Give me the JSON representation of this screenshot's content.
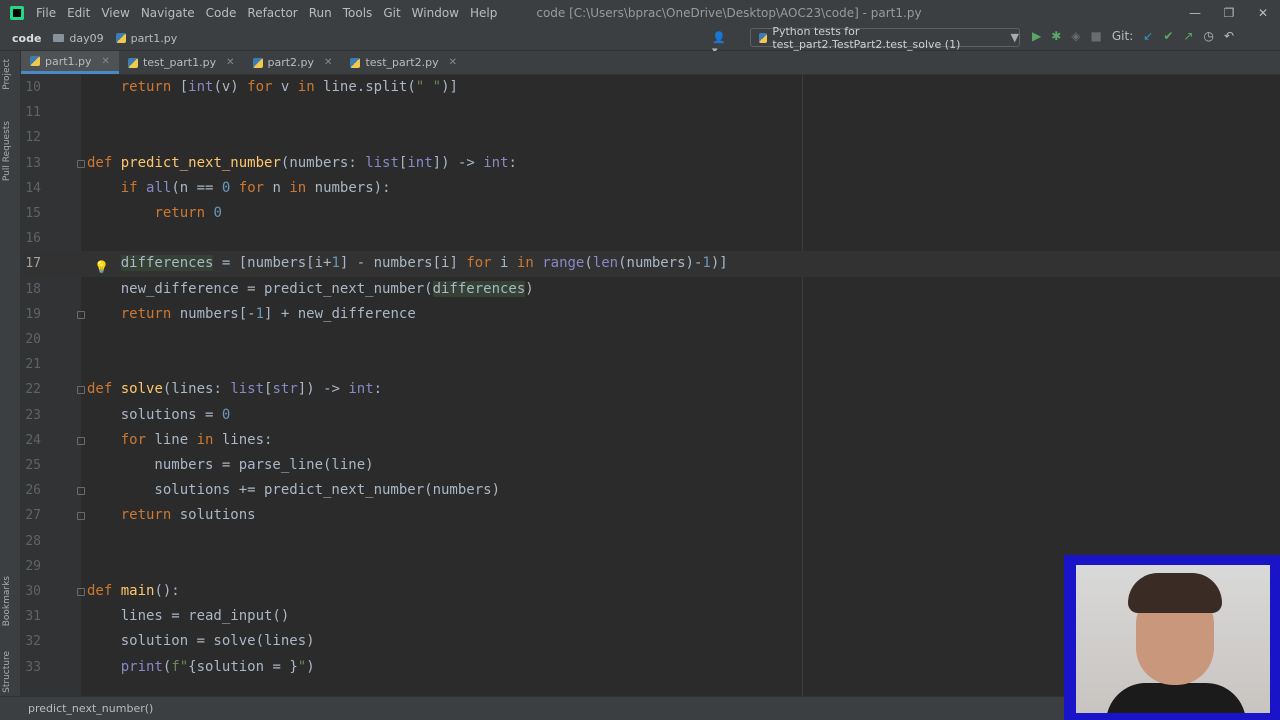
{
  "menubar": {
    "items": [
      "File",
      "Edit",
      "View",
      "Navigate",
      "Code",
      "Refactor",
      "Run",
      "Tools",
      "Git",
      "Window",
      "Help"
    ],
    "title": "code [C:\\Users\\bprac\\OneDrive\\Desktop\\AOC23\\code] - part1.py"
  },
  "navbar": {
    "crumbs": [
      "code",
      "day09",
      "part1.py"
    ],
    "run_config": "Python tests for test_part2.TestPart2.test_solve (1)",
    "git_label": "Git:"
  },
  "side_tabs": [
    "Project",
    "Pull Requests",
    "Bookmarks",
    "Structure"
  ],
  "tabs": [
    {
      "label": "part1.py",
      "active": true
    },
    {
      "label": "test_part1.py",
      "active": false
    },
    {
      "label": "part2.py",
      "active": false
    },
    {
      "label": "test_part2.py",
      "active": false
    }
  ],
  "editor": {
    "lines": [
      {
        "n": "10",
        "html": "    <span class=\"kw\">return</span> [<span class=\"bi\">int</span>(v) <span class=\"kw\">for</span> v <span class=\"kw\">in</span> line.split(<span class=\"str\">\" \"</span>)]"
      },
      {
        "n": "11",
        "html": ""
      },
      {
        "n": "12",
        "html": ""
      },
      {
        "n": "13",
        "html": "<span class=\"kw\">def</span> <span class=\"fn\">predict_next_number</span>(numbers: <span class=\"bi\">list</span>[<span class=\"bi\">int</span>]) -> <span class=\"bi\">int</span>:"
      },
      {
        "n": "14",
        "html": "    <span class=\"kw\">if</span> <span class=\"bi\">all</span>(n == <span class=\"num\">0</span> <span class=\"kw\">for</span> n <span class=\"kw\">in</span> numbers):"
      },
      {
        "n": "15",
        "html": "        <span class=\"kw\">return</span> <span class=\"num\">0</span>"
      },
      {
        "n": "16",
        "html": ""
      },
      {
        "n": "17",
        "html": "    <span class=\"hl\">differences</span> = [numbers[i+<span class=\"num\">1</span>] - numbers[i] <span class=\"kw\">for</span> i <span class=\"kw\">in</span> <span class=\"bi\">range</span>(<span class=\"bi\">len</span>(numbers)-<span class=\"num\">1</span>)]",
        "current": true
      },
      {
        "n": "18",
        "html": "    new_difference = predict_next_number(<span class=\"hl\">differences</span>)"
      },
      {
        "n": "19",
        "html": "    <span class=\"kw\">return</span> numbers[-<span class=\"num\">1</span>] + new_difference"
      },
      {
        "n": "20",
        "html": ""
      },
      {
        "n": "21",
        "html": ""
      },
      {
        "n": "22",
        "html": "<span class=\"kw\">def</span> <span class=\"fn\">solve</span>(lines: <span class=\"bi\">list</span>[<span class=\"bi\">str</span>]) -> <span class=\"bi\">int</span>:"
      },
      {
        "n": "23",
        "html": "    solutions = <span class=\"num\">0</span>"
      },
      {
        "n": "24",
        "html": "    <span class=\"kw\">for</span> line <span class=\"kw\">in</span> lines:"
      },
      {
        "n": "25",
        "html": "        numbers = parse_line(line)"
      },
      {
        "n": "26",
        "html": "        solutions += predict_next_number(numbers)"
      },
      {
        "n": "27",
        "html": "    <span class=\"kw\">return</span> solutions"
      },
      {
        "n": "28",
        "html": ""
      },
      {
        "n": "29",
        "html": ""
      },
      {
        "n": "30",
        "html": "<span class=\"kw\">def</span> <span class=\"fn\">main</span>():"
      },
      {
        "n": "31",
        "html": "    lines = read_input()"
      },
      {
        "n": "32",
        "html": "    solution = solve(lines)"
      },
      {
        "n": "33",
        "html": "    <span class=\"bi\">print</span>(<span class=\"str\">f\"</span>{solution = }<span class=\"str\">\"</span>)"
      }
    ]
  },
  "statusbar": {
    "breadcrumb": "predict_next_number()"
  }
}
